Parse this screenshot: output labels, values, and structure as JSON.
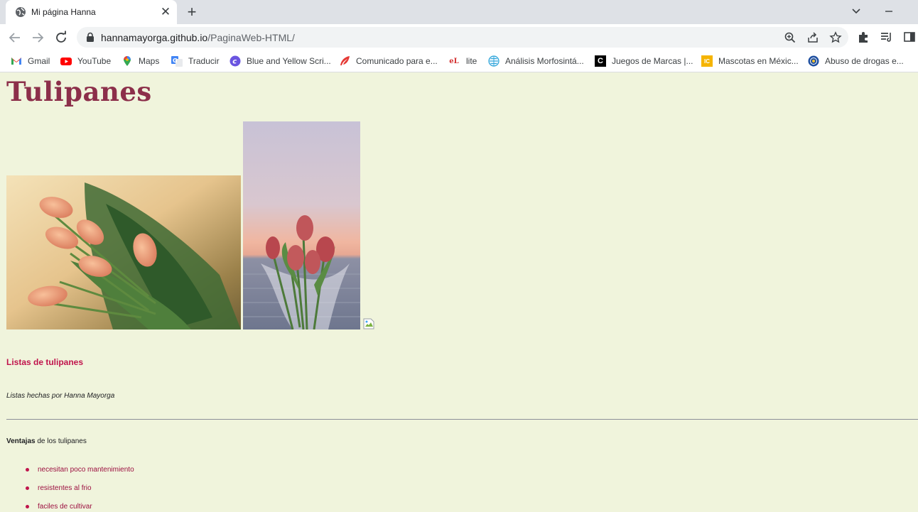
{
  "browser": {
    "tab": {
      "title": "Mi página Hanna"
    },
    "address": {
      "domain": "hannamayorga.github.io",
      "path": "/PaginaWeb-HTML/"
    },
    "bookmarks": [
      {
        "label": "Gmail",
        "icon": "gmail-icon"
      },
      {
        "label": "YouTube",
        "icon": "youtube-icon"
      },
      {
        "label": "Maps",
        "icon": "maps-icon"
      },
      {
        "label": "Traducir",
        "icon": "translate-icon"
      },
      {
        "label": "Blue and Yellow Scri...",
        "icon": "canva-icon"
      },
      {
        "label": "Comunicado para e...",
        "icon": "feather-icon"
      },
      {
        "label": "lite",
        "icon": "el-lite-icon",
        "badge": "eL"
      },
      {
        "label": "Análisis Morfosintá...",
        "icon": "globe-icon"
      },
      {
        "label": "Juegos de Marcas |...",
        "icon": "c-logo-icon",
        "badge": "C"
      },
      {
        "label": "Mascotas en Méxic...",
        "icon": "ic-logo-icon",
        "badge": "IC"
      },
      {
        "label": "Abuso de drogas e...",
        "icon": "seal-icon"
      }
    ]
  },
  "page": {
    "title": "Tulipanes",
    "list_heading": "Listas de tulipanes",
    "byline": "Listas hechas por Hanna Mayorga",
    "advantages_bold": "Ventajas",
    "advantages_rest": " de los tulipanes",
    "advantages": [
      "necesitan poco mantenimiento",
      "resistentes al frio",
      "faciles de cultivar"
    ]
  },
  "colors": {
    "page_background": "#f0f4dc",
    "title": "#8c2f4a",
    "accent": "#c0144c"
  }
}
